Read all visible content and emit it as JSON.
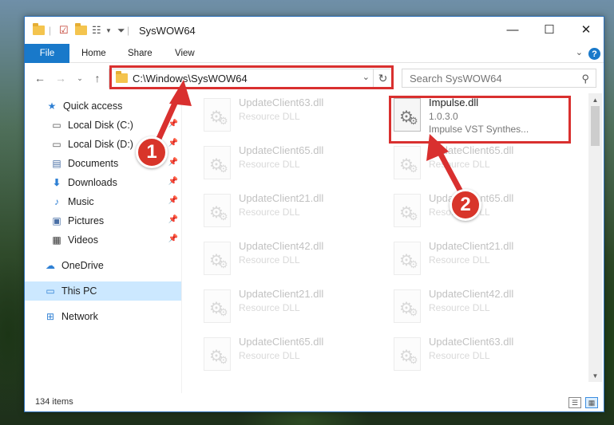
{
  "window": {
    "title": "SysWOW64",
    "controls": {
      "minimize": "—",
      "maximize": "☐",
      "close": "✕"
    }
  },
  "ribbon": {
    "tabs": [
      "File",
      "Home",
      "Share",
      "View"
    ],
    "help": "?"
  },
  "nav": {
    "address": "C:\\Windows\\SysWOW64",
    "search_placeholder": "Search SysWOW64"
  },
  "sidebar": {
    "items": [
      {
        "label": "Quick access",
        "icon": "star-icon"
      },
      {
        "label": "Local Disk (C:)",
        "icon": "drive-icon",
        "pinned": true
      },
      {
        "label": "Local Disk (D:)",
        "icon": "drive-icon",
        "pinned": true
      },
      {
        "label": "Documents",
        "icon": "documents-icon",
        "pinned": true
      },
      {
        "label": "Downloads",
        "icon": "download-icon",
        "pinned": true
      },
      {
        "label": "Music",
        "icon": "music-icon",
        "pinned": true
      },
      {
        "label": "Pictures",
        "icon": "pictures-icon",
        "pinned": true
      },
      {
        "label": "Videos",
        "icon": "videos-icon",
        "pinned": true
      },
      {
        "label": "OneDrive",
        "icon": "cloud-icon"
      },
      {
        "label": "This PC",
        "icon": "computer-icon",
        "selected": true
      },
      {
        "label": "Network",
        "icon": "network-icon"
      }
    ]
  },
  "files": {
    "left": [
      {
        "name": "UpdateClient63.dll",
        "type": "Resource DLL"
      },
      {
        "name": "UpdateClient65.dll",
        "type": "Resource DLL"
      },
      {
        "name": "UpdateClient21.dll",
        "type": "Resource DLL"
      },
      {
        "name": "UpdateClient42.dll",
        "type": "Resource DLL"
      },
      {
        "name": "UpdateClient21.dll",
        "type": "Resource DLL"
      },
      {
        "name": "UpdateClient65.dll",
        "type": "Resource DLL"
      }
    ],
    "right": [
      {
        "name": "Impulse.dll",
        "version": "1.0.3.0",
        "description": "Impulse VST Synthes..."
      },
      {
        "name": "UpdateClient65.dll",
        "type": "Resource DLL"
      },
      {
        "name": "UpdateClient65.dll",
        "type": "Resource DLL"
      },
      {
        "name": "UpdateClient21.dll",
        "type": "Resource DLL"
      },
      {
        "name": "UpdateClient42.dll",
        "type": "Resource DLL"
      },
      {
        "name": "UpdateClient63.dll",
        "type": "Resource DLL"
      }
    ]
  },
  "status": {
    "items_count": "134 items"
  },
  "annotations": {
    "badge1": "1",
    "badge2": "2",
    "color": "#d9302f"
  }
}
